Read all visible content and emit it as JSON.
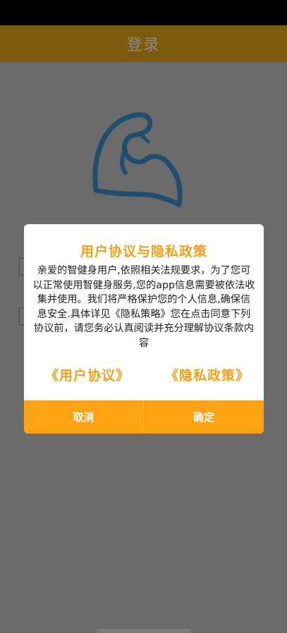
{
  "header": {
    "title": "登录"
  },
  "dialog": {
    "title": "用户协议与隐私政策",
    "body": "亲爱的智健身用户,依照相关法规要求，为了您可以正常使用智健身服务,您的app信息需要被依法收集并使用。我们将严格保护您的个人信息,确保信息安全.具体详见《隐私策略》您在点击同意下列协议前，请您务必认真阅读并充分理解协议条款内容",
    "user_agreement_link": "《用户协议》",
    "privacy_policy_link": "《隐私政策》",
    "cancel_label": "取消",
    "confirm_label": "确定"
  },
  "colors": {
    "accent": "#ffa213",
    "title_accent": "#f2a21a",
    "logo_stroke": "#1f4e6e"
  },
  "icons": {
    "logo": "flexed-arm-icon"
  }
}
